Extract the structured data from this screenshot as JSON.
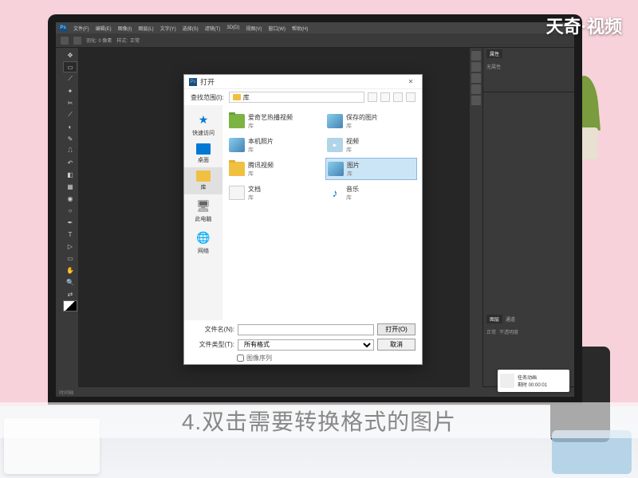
{
  "watermark": "天奇·视频",
  "caption": "4.双击需要转换格式的图片",
  "menubar": {
    "items": [
      "文件(F)",
      "编辑(E)",
      "图像(I)",
      "图层(L)",
      "文字(Y)",
      "选择(S)",
      "滤镜(T)",
      "3D(D)",
      "视图(V)",
      "窗口(W)",
      "帮助(H)"
    ]
  },
  "toolbar": {
    "feather": "羽化: 0 像素",
    "style_label": "样式:",
    "style_value": "正常"
  },
  "ps_footer": "时间轴",
  "right_panel": {
    "tab1": "属性",
    "tab1_body": "无属性",
    "layers_tabs": [
      "图层",
      "通道"
    ],
    "layers_mode": "正常",
    "layers_opacity": "不透明度"
  },
  "dialog": {
    "title": "打开",
    "nav_label": "查找范围(I):",
    "nav_path": "库",
    "sidebar": [
      {
        "label": "快速访问",
        "icon": "star",
        "key": "quick"
      },
      {
        "label": "桌面",
        "icon": "desktop",
        "key": "desktop"
      },
      {
        "label": "库",
        "icon": "lib",
        "key": "lib"
      },
      {
        "label": "此电脑",
        "icon": "pc",
        "key": "pc"
      },
      {
        "label": "网络",
        "icon": "net",
        "key": "net"
      }
    ],
    "files": [
      {
        "name": "爱奇艺热播视频",
        "type": "库",
        "icon": "folder-green"
      },
      {
        "name": "保存的图片",
        "type": "库",
        "icon": "pics"
      },
      {
        "name": "本机照片",
        "type": "库",
        "icon": "pics"
      },
      {
        "name": "视频",
        "type": "库",
        "icon": "video"
      },
      {
        "name": "腾讯视频",
        "type": "库",
        "icon": "folder"
      },
      {
        "name": "图片",
        "type": "库",
        "icon": "pics",
        "selected": true
      },
      {
        "name": "文档",
        "type": "库",
        "icon": "doc"
      },
      {
        "name": "音乐",
        "type": "库",
        "icon": "music"
      }
    ],
    "filename_label": "文件名(N):",
    "filename_value": "",
    "filetype_label": "文件类型(T):",
    "filetype_value": "所有格式",
    "open_btn": "打开(O)",
    "cancel_btn": "取消",
    "checkbox_label": "图像序列"
  },
  "notif": {
    "line1": "任务动画",
    "line2": "剩时 00:00:01"
  },
  "colors": {
    "ps_bg": "#2d2d2d",
    "ps_panel": "#3a3a3a",
    "dialog_sel": "#cce5f6",
    "accent": "#0078d4"
  }
}
